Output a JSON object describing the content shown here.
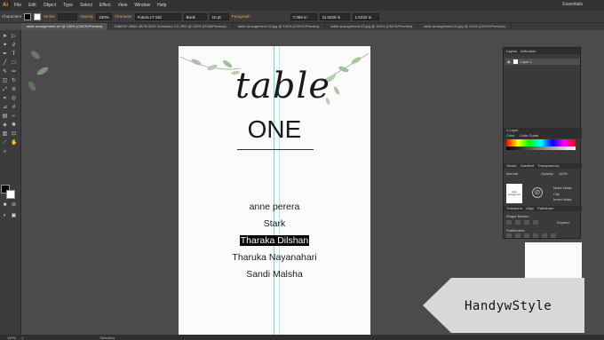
{
  "app": {
    "logo": "Ai",
    "workspace": "Essentials"
  },
  "menu": [
    "File",
    "Edit",
    "Object",
    "Type",
    "Select",
    "Effect",
    "View",
    "Window",
    "Help"
  ],
  "control_bar": {
    "characters_label": "Characters",
    "stroke_label": "Stroke",
    "opacity_label": "Opacity",
    "opacity_value": "100%",
    "character_label": "Character",
    "font_value": "Futura LT Std",
    "style_value": "Book",
    "size_value": "10 pt",
    "paragraph_label": "Paragraph",
    "x_value": "7.056 in",
    "y_value": "11.0229 in",
    "w_value": "1.0432 in"
  },
  "tabs": [
    "table arrangement.ai* @ 100% (CMYK/Preview)",
    "D3BD9F-9B42-4B7B-9D57-Extracted CD.JPG @ 100% (RGB/Preview)",
    "table arrangement 02.jpg @ 100% (CMYK/Preview)",
    "table arrangement 03.jpg @ 100% (CMYK/Preview)",
    "table arrangement 04.jpg @ 100% (CMYK/Preview)"
  ],
  "artboard": {
    "script_title": "table",
    "title": "ONE",
    "names": [
      "anne perera",
      "Stark",
      "Tharaka Dilshan",
      "Tharuka Nayanahari",
      "Sandi Malsha"
    ],
    "selected_name_index": 2
  },
  "layers_panel": {
    "tabs": [
      "Layers",
      "Artboards"
    ],
    "layer_name": "Layer 1",
    "footer": "1 Layer",
    "color_tabs": [
      "Color",
      "Color Guide"
    ],
    "gradient_tabs": [
      "Stroke",
      "Gradient",
      "Transparency"
    ],
    "blend_mode": "Normal",
    "opacity_label": "Opacity:",
    "opacity_value": "100%",
    "make_mask": "Make Mask",
    "clip": "Clip",
    "invert_mask": "Invert Mask",
    "transform_tabs": [
      "Transform",
      "Align",
      "Pathfinder"
    ],
    "shape_modes": "Shape Modes:",
    "expand": "Expand",
    "pathfinders": "Pathfinders:",
    "thumb_text": "table arrangement"
  },
  "status_bar": {
    "zoom": "100%",
    "page": "1",
    "tool": "Selection"
  },
  "watermark": {
    "text": "HandywStyle"
  },
  "colors": {
    "accent_orange": "#f7a11a",
    "guide_cyan": "#5fd3d9",
    "leaf_green": "#9fbf9a"
  }
}
